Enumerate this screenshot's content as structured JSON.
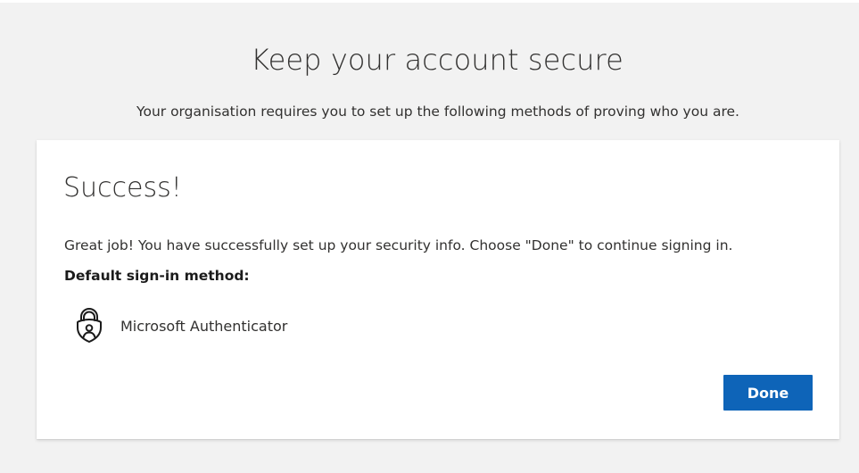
{
  "header": {
    "title": "Keep your account secure",
    "subtitle": "Your organisation requires you to set up the following methods of proving who you are."
  },
  "card": {
    "heading": "Success!",
    "message": "Great job! You have successfully set up your security info. Choose \"Done\" to continue signing in.",
    "default_method_label": "Default sign-in method:",
    "method": {
      "icon": "authenticator-lock-icon",
      "name": "Microsoft Authenticator"
    },
    "done_label": "Done"
  },
  "colors": {
    "background": "#f2f2f2",
    "card": "#ffffff",
    "primary_button": "#0e64b8",
    "text": "#323130"
  }
}
